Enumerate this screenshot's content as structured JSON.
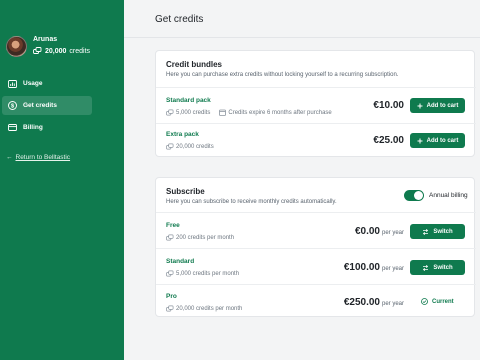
{
  "sidebar": {
    "user": {
      "name": "Arunas",
      "credits_value": "20,000",
      "credits_label": "credits"
    },
    "nav": [
      {
        "label": "Usage",
        "icon": "bar-chart-icon"
      },
      {
        "label": "Get credits",
        "icon": "dollar-icon",
        "active": true
      },
      {
        "label": "Billing",
        "icon": "credit-card-icon"
      }
    ],
    "back_arrow": "←",
    "back_label": "Return to Belltastic"
  },
  "header": {
    "title": "Get credits"
  },
  "bundles": {
    "title": "Credit bundles",
    "subtitle": "Here you can purchase extra credits without locking yourself to a recurring subscription.",
    "items": [
      {
        "name": "Standard pack",
        "credits": "5,000 credits",
        "expiry": "Credits expire 6 months after purchase",
        "price": "€10.00",
        "button": "Add to cart"
      },
      {
        "name": "Extra pack",
        "credits": "20,000 credits",
        "price": "€25.00",
        "button": "Add to cart"
      }
    ]
  },
  "subscribe": {
    "title": "Subscribe",
    "subtitle": "Here you can subscribe to receive monthly credits automatically.",
    "toggle_label": "Annual billing",
    "toggle_on": true,
    "plans": [
      {
        "name": "Free",
        "credits": "200 credits per month",
        "price": "€0.00",
        "period": "per year",
        "action": "Switch"
      },
      {
        "name": "Standard",
        "credits": "5,000 credits per month",
        "price": "€100.00",
        "period": "per year",
        "action": "Switch"
      },
      {
        "name": "Pro",
        "credits": "20,000 credits per month",
        "price": "€250.00",
        "period": "per year",
        "action": "Current"
      }
    ]
  },
  "colors": {
    "brand": "#0f7a4e",
    "background": "#f3f4f5",
    "card": "#ffffff"
  }
}
